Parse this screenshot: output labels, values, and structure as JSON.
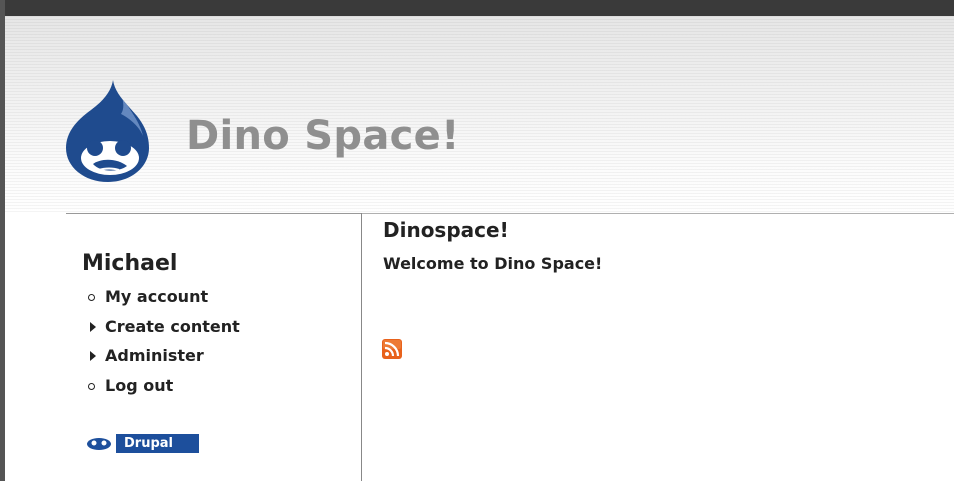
{
  "header": {
    "site_name": "Dino Space!",
    "brand_color": "#1f4b8e"
  },
  "sidebar": {
    "user_name": "Michael",
    "items": [
      {
        "label": "My account",
        "bullet": "circle"
      },
      {
        "label": "Create content",
        "bullet": "triangle"
      },
      {
        "label": "Administer",
        "bullet": "triangle"
      },
      {
        "label": "Log out",
        "bullet": "circle"
      }
    ],
    "powered_by": "Drupal"
  },
  "main": {
    "title": "Dinospace!",
    "body": "Welcome to Dino Space!",
    "feed_icon": "rss-feed-icon"
  }
}
